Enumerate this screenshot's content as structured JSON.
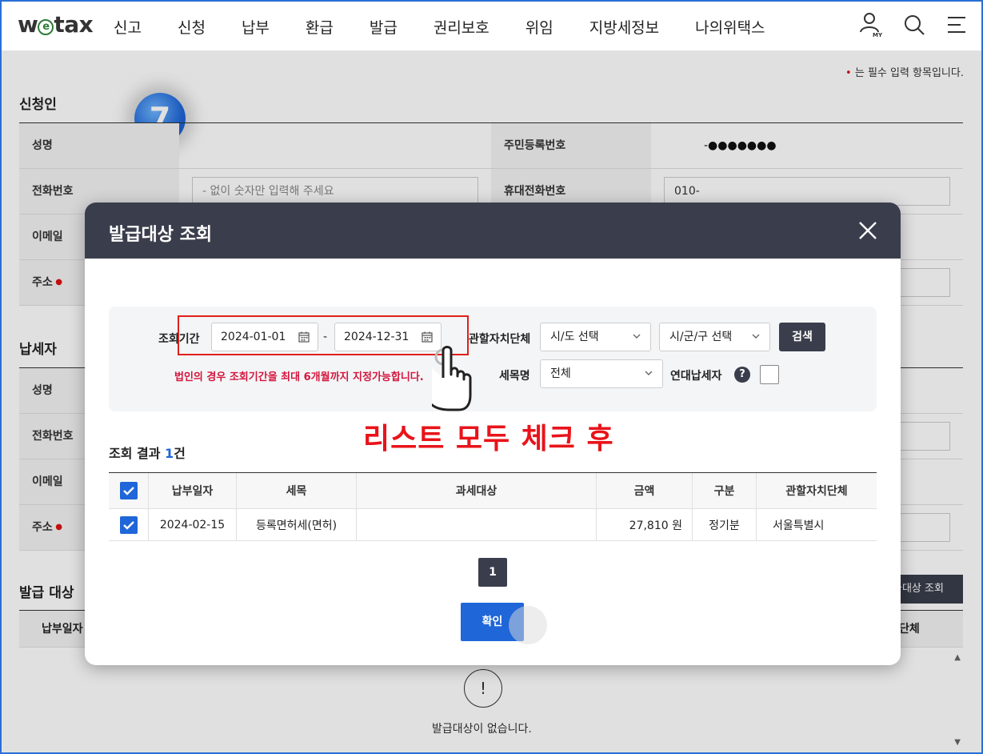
{
  "brand": {
    "logo_pre": "w",
    "logo_e": "e",
    "logo_post": "tax"
  },
  "nav": {
    "items": [
      "신고",
      "신청",
      "납부",
      "환급",
      "발급",
      "권리보호",
      "위임",
      "지방세정보",
      "나의위택스"
    ],
    "my_label": "MY"
  },
  "page": {
    "required_note": "는 필수 입력 항목입니다.",
    "applicant": {
      "title": "신청인",
      "name_label": "성명",
      "rrn_label": "주민등록번호",
      "rrn_value": "-●●●●●●●",
      "phone_label": "전화번호",
      "phone_placeholder": "- 없이 숫자만 입력해 주세요",
      "mobile_label": "휴대전화번호",
      "mobile_value": "010-",
      "email_label": "이메일",
      "address_label": "주소"
    },
    "taxpayer": {
      "title": "납세자",
      "name_label": "성명",
      "phone_label": "전화번호",
      "email_label": "이메일",
      "address_label": "주소"
    },
    "issue": {
      "title": "발급 대상",
      "col_date": "납부일자",
      "col_local_gov": "단체",
      "button": "급대상 조회",
      "empty_text": "발급대상이 없습니다."
    },
    "step_badge": "7"
  },
  "modal": {
    "title": "발급대상 조회",
    "period_label": "조회기간",
    "date_from": "2024-01-01",
    "date_to": "2024-12-31",
    "date_sep": "-",
    "local_gov_label": "관할자치단체",
    "sido_select": "시/도 선택",
    "sigungu_select": "시/군/구 선택",
    "search_button": "검색",
    "warning": "법인의 경우 조회기간을 최대 6개월까지 지정가능합니다.",
    "tax_item_label": "세목명",
    "tax_item_select": "전체",
    "joint_taxpayer_label": "연대납세자",
    "help_symbol": "?",
    "annotation": "리스트 모두 체크 후",
    "result_prefix": "조회 결과 ",
    "result_count": "1",
    "result_suffix": "건",
    "table": {
      "headers": [
        "납부일자",
        "세목",
        "과세대상",
        "금액",
        "구분",
        "관할자치단체"
      ],
      "rows": [
        {
          "date": "2024-02-15",
          "tax": "등록면허세(면허)",
          "target": "",
          "amount": "27,810 원",
          "type": "정기분",
          "local_gov": "서울특별시"
        }
      ]
    },
    "page_current": "1",
    "confirm_button": "확인"
  },
  "colors": {
    "accent": "#1f66d8",
    "header_dark": "#3a3e4c",
    "annotation_red": "#e8141a",
    "warning_red": "#d4163c"
  }
}
